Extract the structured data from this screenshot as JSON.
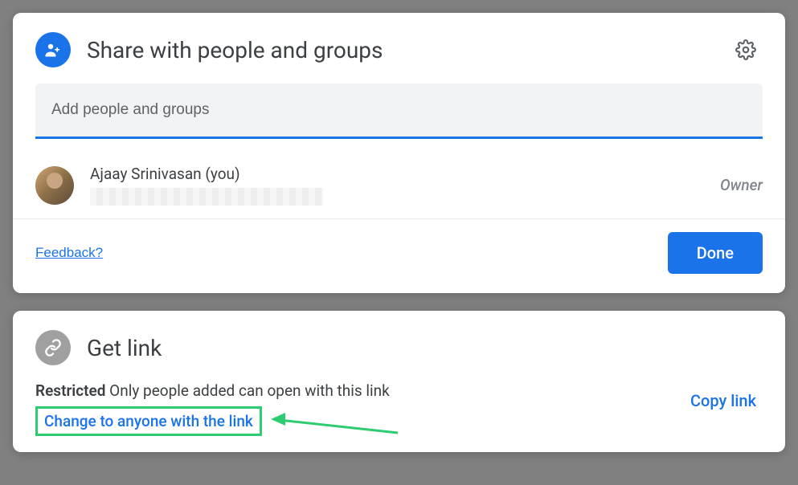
{
  "share": {
    "title": "Share with people and groups",
    "input_placeholder": "Add people and groups",
    "person_name": "Ajaay Srinivasan (you)",
    "person_role": "Owner",
    "feedback": "Feedback?",
    "done": "Done"
  },
  "getlink": {
    "title": "Get link",
    "restricted_label": "Restricted",
    "restricted_desc": " Only people added can open with this link",
    "change_link": "Change to anyone with the link",
    "copy_link": "Copy link"
  }
}
